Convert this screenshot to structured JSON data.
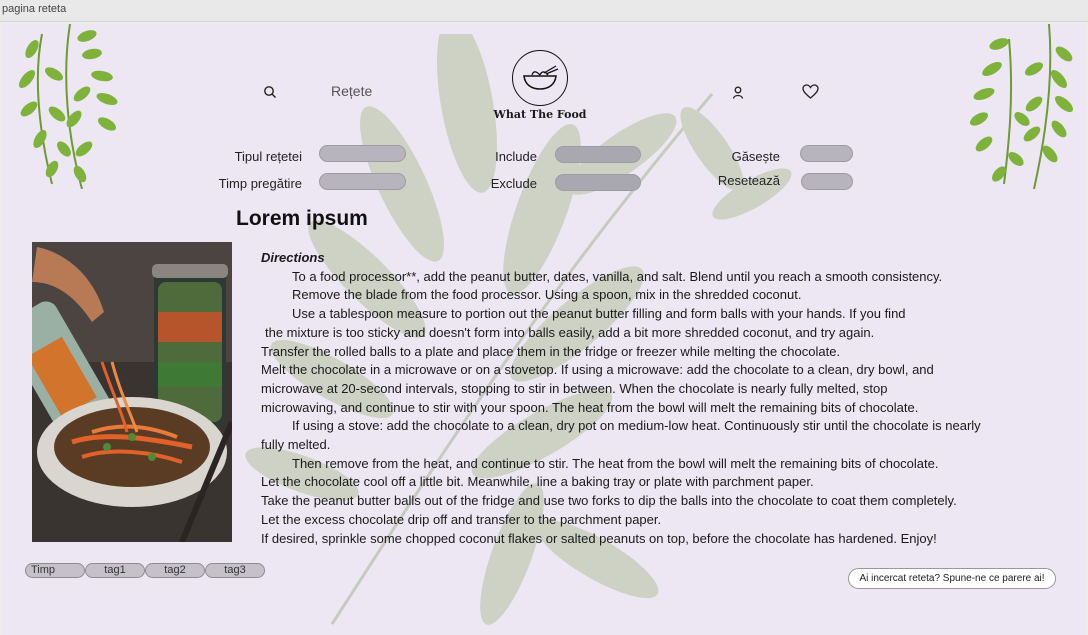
{
  "window": {
    "title": "pagina reteta"
  },
  "nav": {
    "recipes_label": "Rețete",
    "icons": [
      "search-icon",
      "user-icon",
      "heart-icon"
    ]
  },
  "logo": {
    "brand": "What The Food",
    "icon": "bowl-icon"
  },
  "filters": {
    "recipe_type": "Tipul rețetei",
    "prep_time": "Timp pregătire",
    "include": "Include",
    "exclude": "Exclude",
    "find": "Găsește",
    "reset": "Resetează"
  },
  "recipe": {
    "title": "Lorem ipsum",
    "directions_heading": "Directions",
    "lines": [
      "To a food processor**, add the peanut butter, dates, vanilla, and salt. Blend until you reach a smooth consistency.",
      "Remove the blade from the food processor. Using a spoon, mix in the shredded coconut.",
      "Use a tablespoon measure to portion out the peanut butter filling and form balls with your hands. If you find",
      "the mixture is too sticky and doesn't form into balls easily, add a bit more shredded coconut, and try again.",
      "Transfer the rolled balls to a plate and place them in the fridge or freezer while melting the chocolate.",
      "Melt the chocolate in a microwave or on a stovetop. If using a microwave: add the chocolate to a clean, dry bowl, and",
      "microwave at 20-second intervals, stopping to stir in between. When the chocolate is nearly fully melted, stop",
      "microwaving, and continue to stir with your spoon. The heat from the bowl will melt the remaining bits of chocolate.",
      "If using a stove: add the chocolate to a clean, dry pot on medium-low heat. Continuously stir until the chocolate is nearly",
      "fully melted.",
      "Then remove from the heat, and continue to stir. The heat from the bowl will melt the remaining bits of chocolate.",
      "Let the chocolate cool off a little bit. Meanwhile, line a baking tray or plate with parchment paper.",
      "Take the peanut butter balls out of the fridge and use two forks to dip the balls into the chocolate to coat them completely.",
      "Let the excess chocolate drip off and transfer to the parchment paper.",
      "If desired, sprinkle some chopped coconut flakes or salted peanuts on top, before the chocolate has hardened. Enjoy!"
    ]
  },
  "tags": [
    "Timp",
    "tag1",
    "tag2",
    "tag3"
  ],
  "feedback_label": "Ai incercat reteta? Spune-ne ce parere ai!",
  "colors": {
    "background": "#ece7f2",
    "pill": "#b7b4be",
    "leaf": "#7fb23a"
  }
}
